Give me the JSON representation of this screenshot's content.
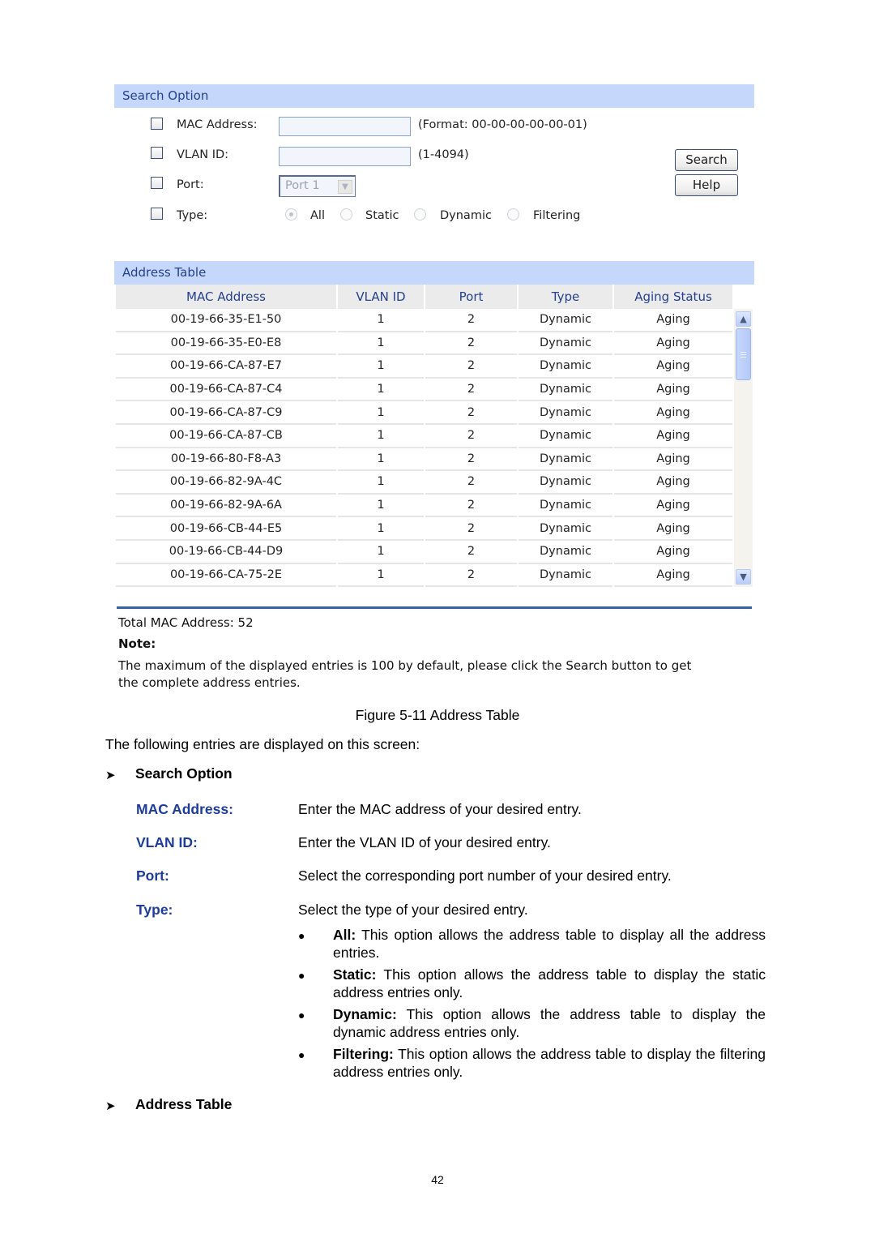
{
  "figure": {
    "search_option": {
      "title": "Search Option",
      "fields": {
        "mac": {
          "label": "MAC Address:",
          "value": "",
          "hint": "(Format: 00-00-00-00-00-01)",
          "checked": false
        },
        "vlan": {
          "label": "VLAN ID:",
          "value": "",
          "hint": "(1-4094)",
          "checked": false
        },
        "port": {
          "label": "Port:",
          "selected": "Port 1",
          "checked": false
        },
        "type": {
          "label": "Type:",
          "checked": false,
          "options": [
            "All",
            "Static",
            "Dynamic",
            "Filtering"
          ],
          "selected": "All"
        }
      },
      "buttons": {
        "search": "Search",
        "help": "Help"
      }
    },
    "address_table": {
      "title": "Address Table",
      "columns": [
        "MAC Address",
        "VLAN ID",
        "Port",
        "Type",
        "Aging Status"
      ],
      "rows": [
        [
          "00-19-66-35-E1-50",
          "1",
          "2",
          "Dynamic",
          "Aging"
        ],
        [
          "00-19-66-35-E0-E8",
          "1",
          "2",
          "Dynamic",
          "Aging"
        ],
        [
          "00-19-66-CA-87-E7",
          "1",
          "2",
          "Dynamic",
          "Aging"
        ],
        [
          "00-19-66-CA-87-C4",
          "1",
          "2",
          "Dynamic",
          "Aging"
        ],
        [
          "00-19-66-CA-87-C9",
          "1",
          "2",
          "Dynamic",
          "Aging"
        ],
        [
          "00-19-66-CA-87-CB",
          "1",
          "2",
          "Dynamic",
          "Aging"
        ],
        [
          "00-19-66-80-F8-A3",
          "1",
          "2",
          "Dynamic",
          "Aging"
        ],
        [
          "00-19-66-82-9A-4C",
          "1",
          "2",
          "Dynamic",
          "Aging"
        ],
        [
          "00-19-66-82-9A-6A",
          "1",
          "2",
          "Dynamic",
          "Aging"
        ],
        [
          "00-19-66-CB-44-E5",
          "1",
          "2",
          "Dynamic",
          "Aging"
        ],
        [
          "00-19-66-CB-44-D9",
          "1",
          "2",
          "Dynamic",
          "Aging"
        ],
        [
          "00-19-66-CA-75-2E",
          "1",
          "2",
          "Dynamic",
          "Aging"
        ]
      ]
    },
    "total": "Total MAC Address: 52",
    "note_label": "Note:",
    "note_text": "The maximum of the displayed entries is 100 by default, please click the Search button to get the complete address entries.",
    "caption": "Figure 5-11 Address Table"
  },
  "doc": {
    "intro": "The following entries are displayed on this screen:",
    "section1": "Search Option",
    "terms": [
      {
        "term": "MAC Address:",
        "desc": "Enter the MAC address of your desired entry."
      },
      {
        "term": "VLAN ID:",
        "desc": "Enter the VLAN ID of your desired entry."
      },
      {
        "term": "Port:",
        "desc": "Select the corresponding port number of your desired entry."
      },
      {
        "term": "Type:",
        "desc": "Select the type of your desired entry."
      }
    ],
    "bullets": [
      {
        "bold": "All:",
        "text": " This option allows the address table to display all the address entries."
      },
      {
        "bold": "Static:",
        "text": " This option allows the address table to display the static address entries only."
      },
      {
        "bold": "Dynamic:",
        "text": " This option allows the address table to display the dynamic address entries only."
      },
      {
        "bold": "Filtering:",
        "text": " This option allows the address table to display the filtering address entries only."
      }
    ],
    "section2": "Address Table",
    "page_number": "42"
  }
}
